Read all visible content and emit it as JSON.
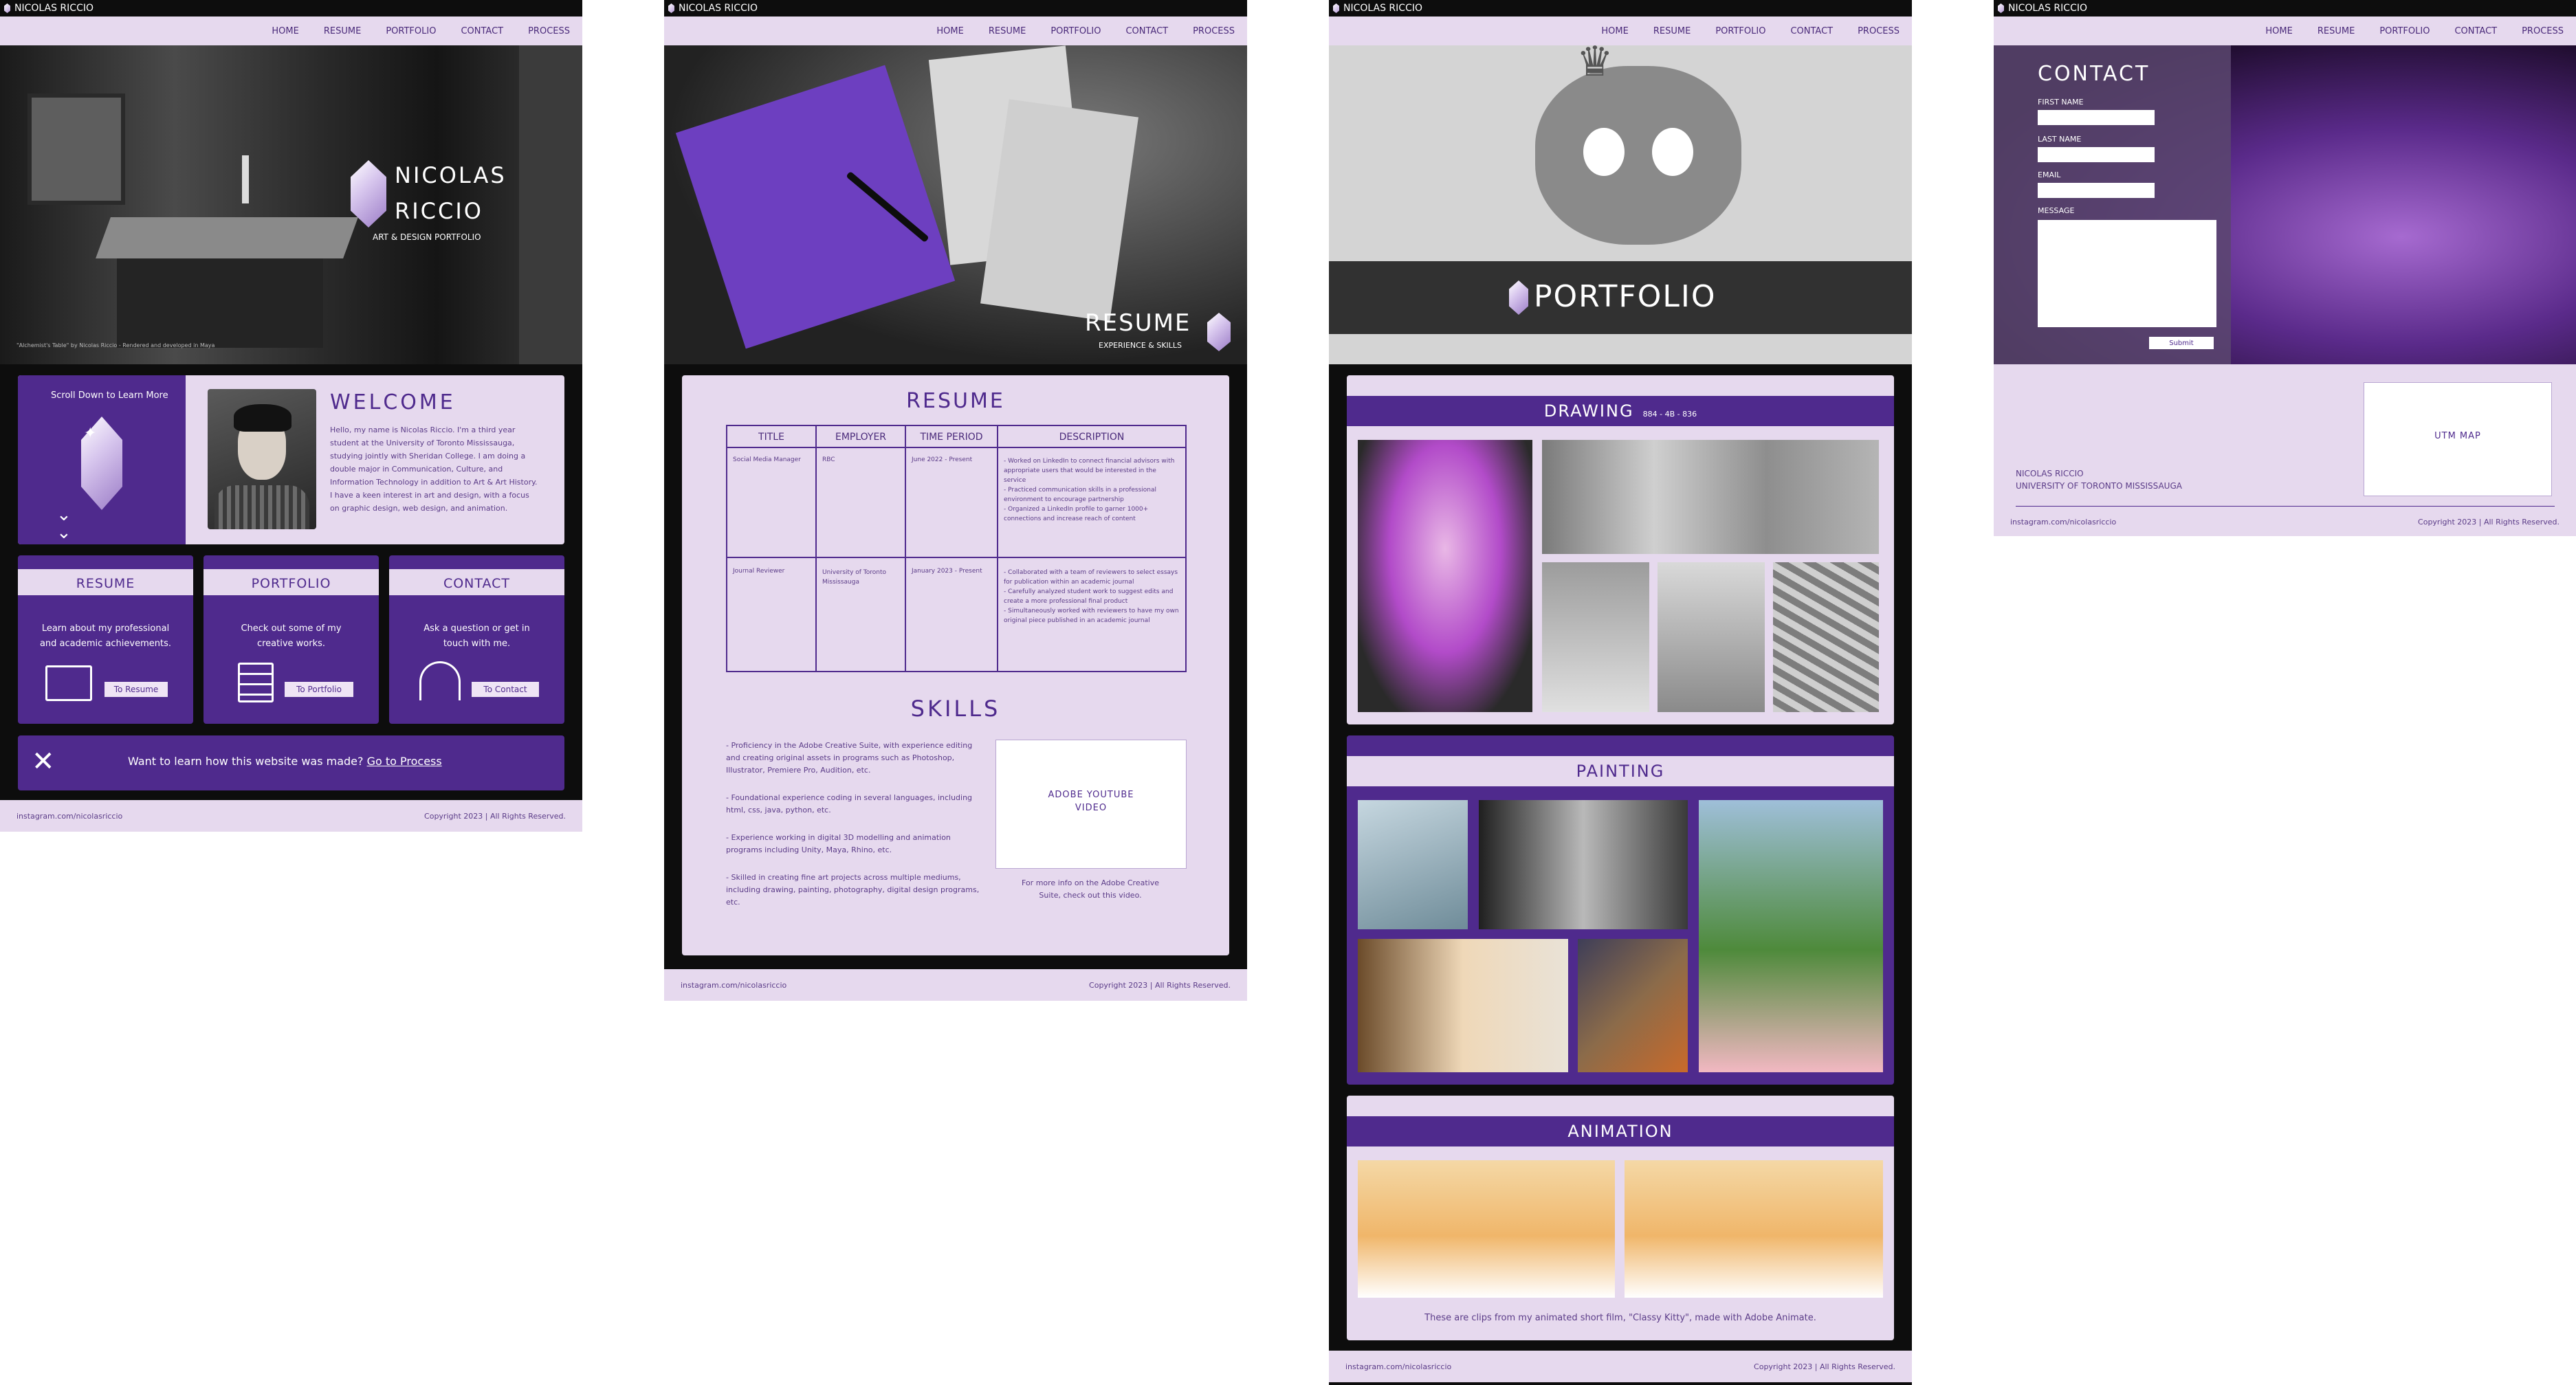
{
  "site": {
    "brand": "NICOLAS RICCIO",
    "nav": [
      "HOME",
      "RESUME",
      "PORTFOLIO",
      "CONTACT",
      "PROCESS"
    ],
    "footer_left": "instagram.com/nicolasriccio",
    "footer_right": "Copyright 2023 | All Rights Reserved."
  },
  "home": {
    "hero_name1": "NICOLAS",
    "hero_name2": "RICCIO",
    "hero_sub": "ART & DESIGN PORTFOLIO",
    "hero_caption": "\"Alchemist's Table\" by Nicolas Riccio - Rendered and developed in Maya",
    "scroll_text": "Scroll Down to Learn More",
    "welcome_title": "WELCOME",
    "welcome_body": "Hello, my name is Nicolas Riccio. I'm a third year student at the University of Toronto Mississauga, studying jointly with Sheridan College. I am doing a double major in Communication, Culture, and Information Technology in addition to Art & Art History. I have a keen interest in art and design, with a focus on graphic design, web design, and animation.",
    "cards": [
      {
        "title": "RESUME",
        "text": "Learn about my professional and academic achievements.",
        "button": "To Resume"
      },
      {
        "title": "PORTFOLIO",
        "text": "Check out some of my creative works.",
        "button": "To Portfolio"
      },
      {
        "title": "CONTACT",
        "text": "Ask a question or get in touch with me.",
        "button": "To Contact"
      }
    ],
    "process_text": "Want to learn how this website was made?",
    "process_link": "Go to Process"
  },
  "resume": {
    "hero_title": "RESUME",
    "hero_sub": "EXPERIENCE & SKILLS",
    "section_title": "RESUME",
    "columns": [
      "TITLE",
      "EMPLOYER",
      "TIME PERIOD",
      "DESCRIPTION"
    ],
    "rows": [
      {
        "title": "Social Media Manager",
        "employer": "RBC",
        "period": "June 2022 - Present",
        "desc": [
          "- Worked on LinkedIn to connect financial advisors with appropriate users that would be interested in the service",
          "- Practiced communication skills in a professional environment to encourage partnership",
          "- Organized a LinkedIn profile to garner 1000+ connections and increase reach of content"
        ]
      },
      {
        "title": "Journal Reviewer",
        "employer": "University of Toronto Mississauga",
        "period": "January 2023 - Present",
        "desc": [
          "- Collaborated with a team of reviewers to select essays for publication within an academic journal",
          "- Carefully analyzed student work to suggest edits and create a more professional final product",
          "- Simultaneously worked with reviewers to have my own original piece published in an academic journal"
        ]
      }
    ],
    "skills_title": "SKILLS",
    "skills": [
      "- Proficiency in the Adobe Creative Suite, with experience editing and creating original assets in programs such as Photoshop, Illustrator, Premiere Pro, Audition, etc.",
      "- Foundational experience coding in several languages, including html, css, java, python, etc.",
      "- Experience working in digital 3D modelling and animation programs including Unity, Maya, Rhino, etc.",
      "- Skilled in creating fine art projects across multiple mediums, including drawing, painting, photography, digital design programs, etc."
    ],
    "video_label1": "ADOBE YOUTUBE",
    "video_label2": "VIDEO",
    "video_caption": "For more info on the Adobe Creative Suite, check out this video."
  },
  "portfolio": {
    "hero_title": "PORTFOLIO",
    "drawing_title": "DRAWING",
    "drawing_sub": "884 - 4B - 836",
    "painting_title": "PAINTING",
    "animation_title": "ANIMATION",
    "animation_caption": "These are clips from my animated short film, \"Classy Kitty\", made with Adobe Animate."
  },
  "contact": {
    "title": "CONTACT",
    "labels": [
      "FIRST NAME",
      "LAST NAME",
      "EMAIL",
      "MESSAGE"
    ],
    "submit": "Submit",
    "map_label": "UTM MAP",
    "name": "NICOLAS RICCIO",
    "school": "UNIVERSITY OF TORONTO MISSISSAUGA"
  },
  "colors": {
    "purple": "#4f2a8d",
    "lavender": "#e6d9ee",
    "dark": "#0d0d0d"
  }
}
